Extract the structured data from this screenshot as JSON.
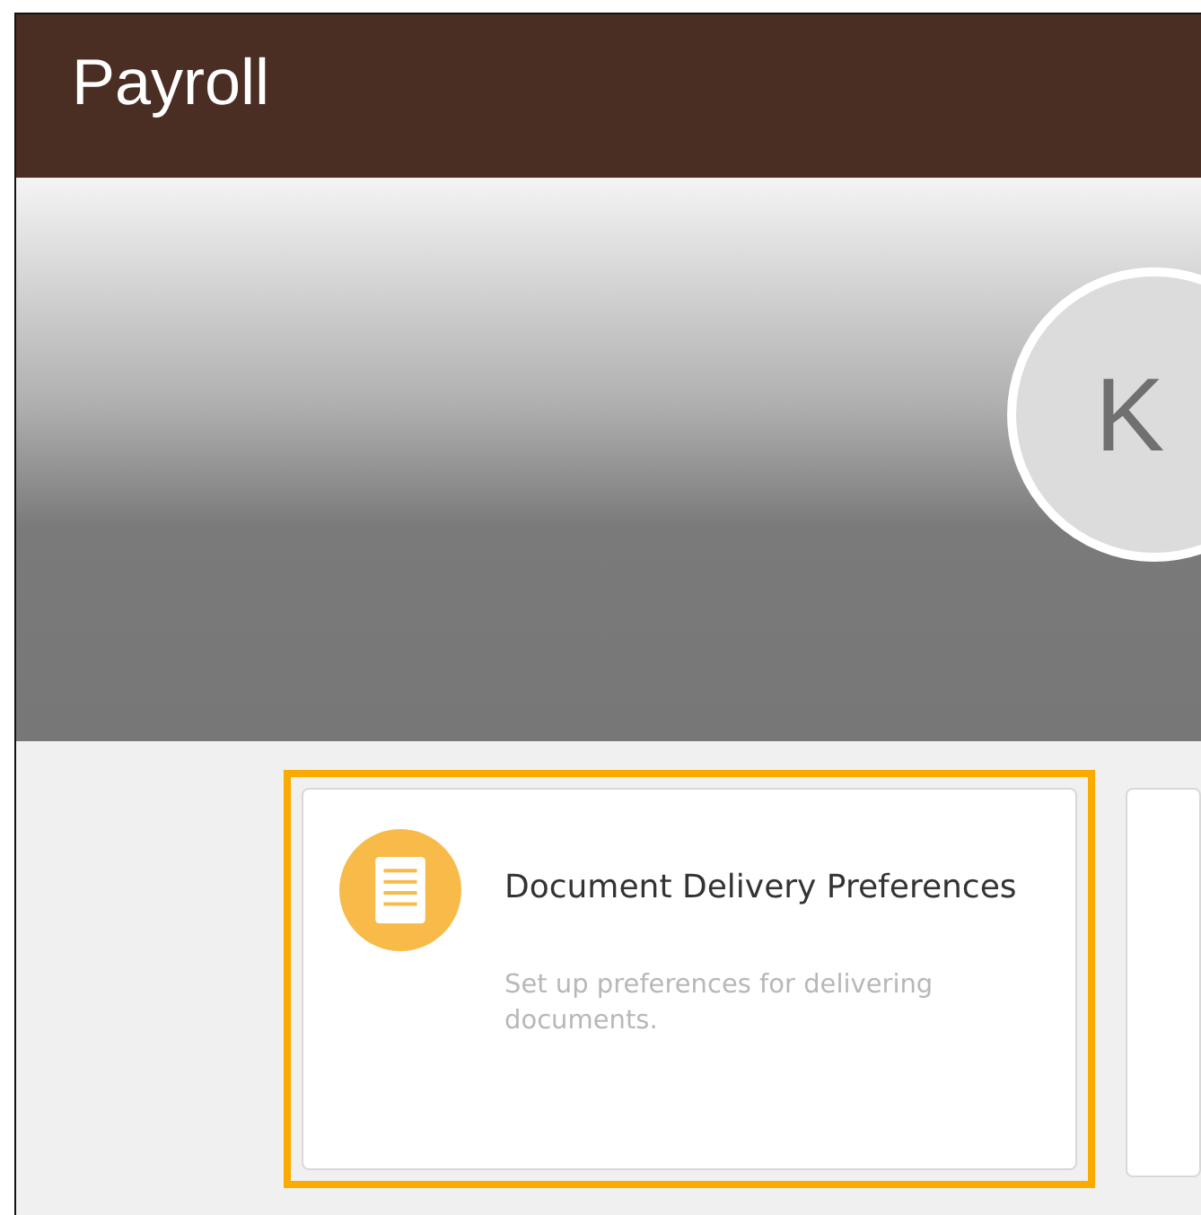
{
  "header": {
    "title": "Payroll"
  },
  "profile": {
    "initials": "K"
  },
  "cards": [
    {
      "title": "Document Delivery Preferences",
      "description": "Set up preferences for delivering documents.",
      "selected": true
    }
  ]
}
